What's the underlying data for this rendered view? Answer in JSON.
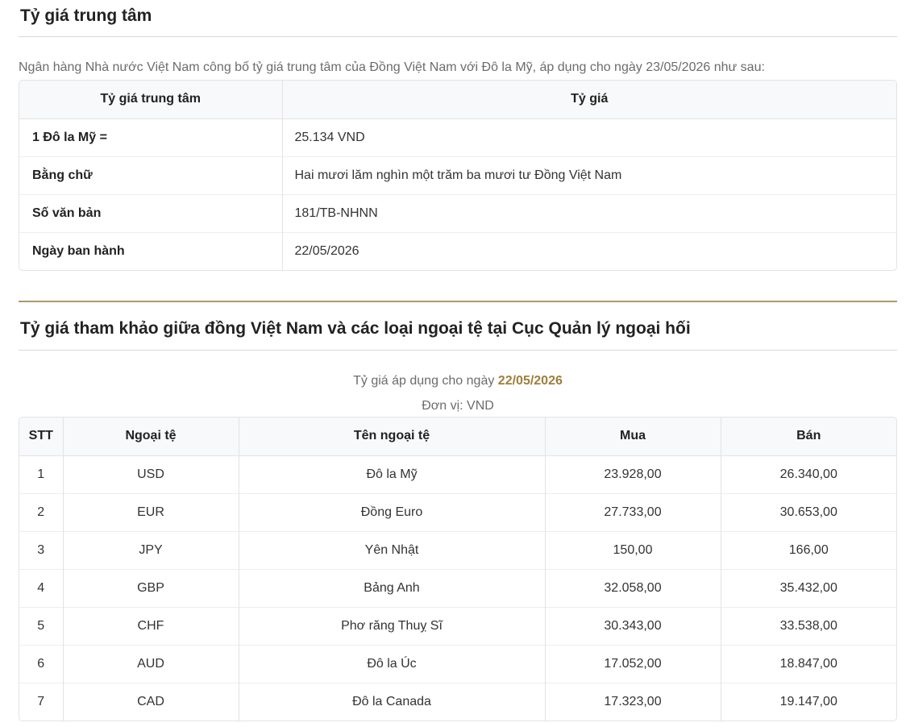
{
  "central_rate": {
    "title": "Tỷ giá trung tâm",
    "intro": "Ngân hàng Nhà nước Việt Nam công bố tỷ giá trung tâm của Đồng Việt Nam với Đô la Mỹ, áp dụng cho ngày 23/05/2026 như sau:",
    "headers": [
      "Tỷ giá trung tâm",
      "Tỷ giá"
    ],
    "rows": [
      {
        "label": "1 Đô la Mỹ =",
        "value": "25.134 VND"
      },
      {
        "label": "Bằng chữ",
        "value": "Hai mươi lăm nghìn một trăm ba mươi tư Đồng Việt Nam"
      },
      {
        "label": "Số văn bản",
        "value": "181/TB-NHNN"
      },
      {
        "label": "Ngày ban hành",
        "value": "22/05/2026"
      }
    ]
  },
  "reference_rates": {
    "title": "Tỷ giá tham khảo giữa đồng Việt Nam và các loại ngoại tệ tại Cục Quản lý ngoại hối",
    "applied_prefix": "Tỷ giá áp dụng cho ngày",
    "applied_date": "22/05/2026",
    "unit": "Đơn vị: VND",
    "headers": [
      "STT",
      "Ngoại tệ",
      "Tên ngoại tệ",
      "Mua",
      "Bán"
    ],
    "rows": [
      {
        "stt": "1",
        "code": "USD",
        "name": "Đô la Mỹ",
        "buy": "23.928,00",
        "sell": "26.340,00"
      },
      {
        "stt": "2",
        "code": "EUR",
        "name": "Đồng Euro",
        "buy": "27.733,00",
        "sell": "30.653,00"
      },
      {
        "stt": "3",
        "code": "JPY",
        "name": "Yên Nhật",
        "buy": "150,00",
        "sell": "166,00"
      },
      {
        "stt": "4",
        "code": "GBP",
        "name": "Bảng Anh",
        "buy": "32.058,00",
        "sell": "35.432,00"
      },
      {
        "stt": "5",
        "code": "CHF",
        "name": "Phơ răng Thuỵ Sĩ",
        "buy": "30.343,00",
        "sell": "33.538,00"
      },
      {
        "stt": "6",
        "code": "AUD",
        "name": "Đô la Úc",
        "buy": "17.052,00",
        "sell": "18.847,00"
      },
      {
        "stt": "7",
        "code": "CAD",
        "name": "Đô la Canada",
        "buy": "17.323,00",
        "sell": "19.147,00"
      }
    ]
  }
}
